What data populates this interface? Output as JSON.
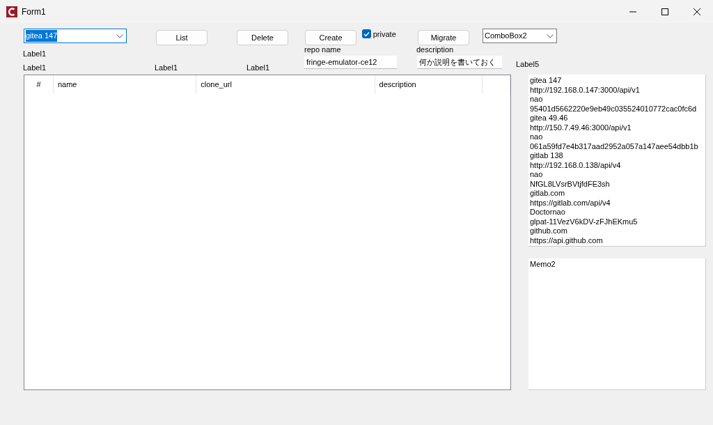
{
  "window": {
    "title": "Form1"
  },
  "combo1": {
    "value": "gitea 147",
    "selected_text": true
  },
  "buttons": [
    {
      "label": "List"
    },
    {
      "label": "Delete"
    },
    {
      "label": "Create"
    },
    {
      "label": "Migrate"
    }
  ],
  "private_checkbox": {
    "label": "private",
    "checked": true
  },
  "combo2": {
    "value": "ComboBox2"
  },
  "labels": [
    "Label1",
    "Label1",
    "Label1",
    "Label1"
  ],
  "repo_name": {
    "label": "repo name",
    "value": "fringe-emulator-ce12"
  },
  "description": {
    "label": "description",
    "value": "何か説明を書いておく"
  },
  "label5": "Label5",
  "table": {
    "columns": [
      "#",
      "name",
      "clone_url",
      "description"
    ]
  },
  "memo1": {
    "lines": [
      "gitea 147",
      "http://192.168.0.147:3000/api/v1",
      "nao",
      "95401d5662220e9eb49c035524010772cac0fc6d",
      "gitea 49.46",
      "http://150.7.49.46:3000/api/v1",
      "nao",
      "061a59fd7e4b317aad2952a057a147aee54dbb1b",
      "gitlab 138",
      "http://192.168.0.138/api/v4",
      "nao",
      "NfGL8LVsrBVtjfdFE3sh",
      "gitlab.com",
      "https://gitlab.com/api/v4",
      "Doctornao",
      "glpat-11VezV6kDV-zFJhEKmu5",
      "github.com",
      "https://api.github.com"
    ]
  },
  "memo2": {
    "lines": [
      "Memo2"
    ]
  }
}
